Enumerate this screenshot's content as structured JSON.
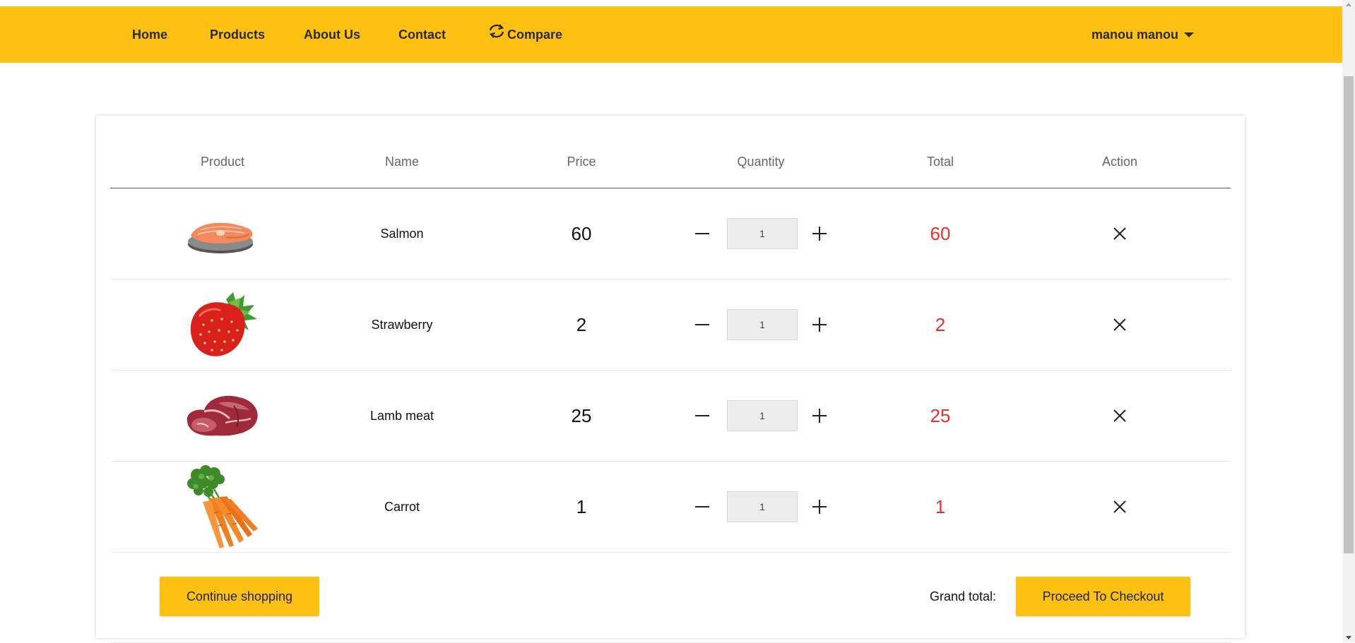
{
  "top_strip": {
    "tag": "... ... ..."
  },
  "nav": {
    "items": [
      {
        "label": "Home"
      },
      {
        "label": "Products"
      },
      {
        "label": "About Us"
      },
      {
        "label": "Contact"
      },
      {
        "label": "Compare",
        "icon": "sync-icon"
      }
    ],
    "user": {
      "name": "manou manou",
      "icon": "caret-down-icon"
    }
  },
  "cart": {
    "headers": [
      "Product",
      "Name",
      "Price",
      "Quantity",
      "Total",
      "Action"
    ],
    "rows": [
      {
        "name": "Salmon",
        "price": "60",
        "quantity": "1",
        "total": "60",
        "image": "salmon-image"
      },
      {
        "name": "Strawberry",
        "price": "2",
        "quantity": "1",
        "total": "2",
        "image": "strawberry-image"
      },
      {
        "name": "Lamb meat",
        "price": "25",
        "quantity": "1",
        "total": "25",
        "image": "lamb-meat-image"
      },
      {
        "name": "Carrot",
        "price": "1",
        "quantity": "1",
        "total": "1",
        "image": "carrot-image"
      }
    ],
    "continue_label": "Continue shopping",
    "grand_total_label": "Grand total:",
    "checkout_label": "Proceed To Checkout"
  },
  "colors": {
    "nav_bg": "#fec111",
    "button_bg": "#fec111",
    "total_text": "#e8302a"
  }
}
